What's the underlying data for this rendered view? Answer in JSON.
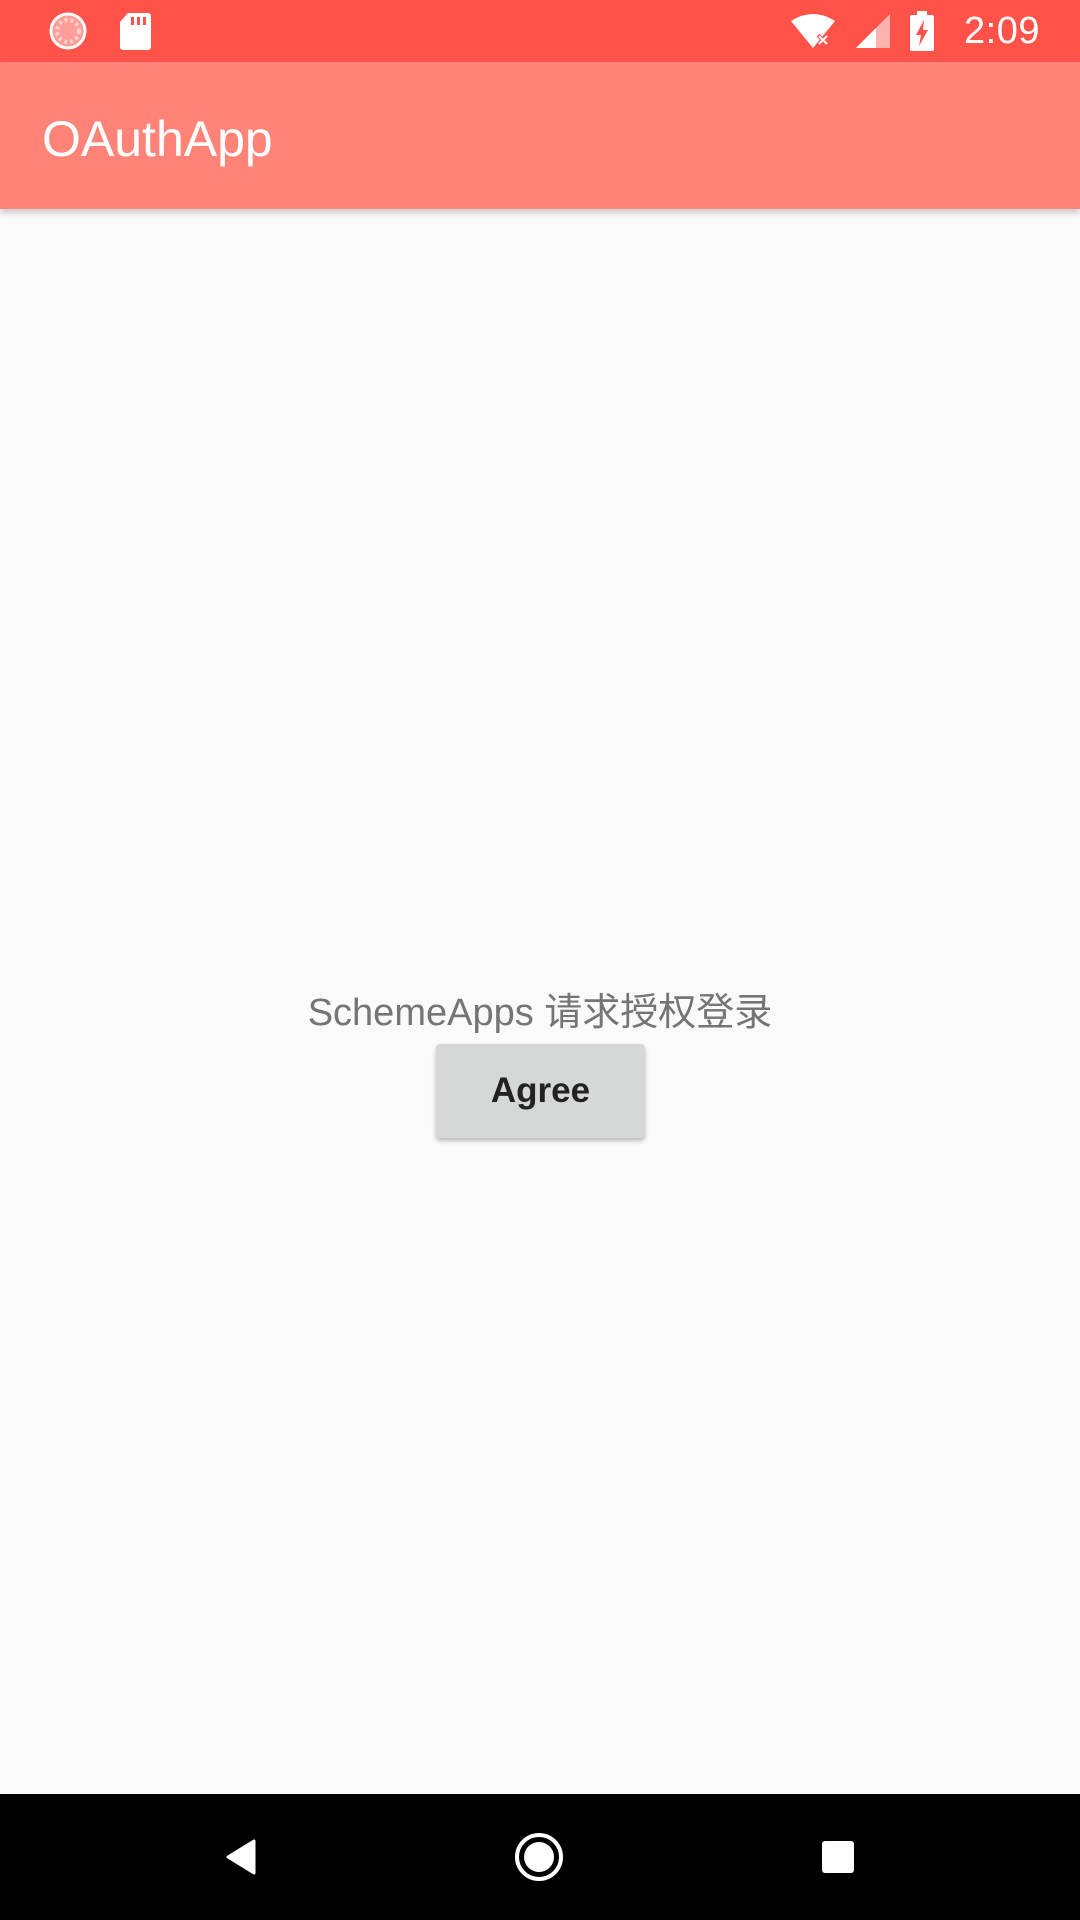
{
  "status_bar": {
    "time": "2:09",
    "background_color": "#ff534a",
    "icons": [
      "loading-circle-icon",
      "sd-card-icon",
      "wifi-no-internet-icon",
      "cell-signal-icon",
      "battery-charging-icon"
    ]
  },
  "app_bar": {
    "title": "OAuthApp",
    "background_color": "#ff8477"
  },
  "main": {
    "prompt": "SchemeApps 请求授权登录",
    "agree_label": "Agree"
  },
  "nav_bar": {
    "icons": [
      "back-icon",
      "home-icon",
      "recents-icon"
    ]
  }
}
